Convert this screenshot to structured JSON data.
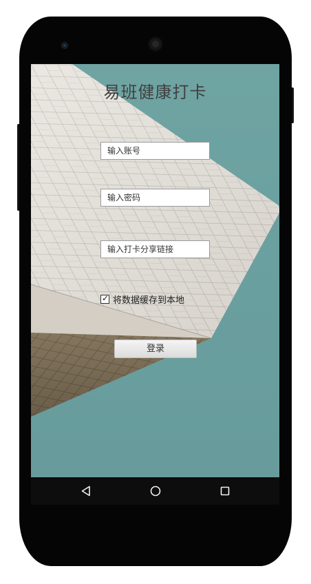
{
  "app": {
    "title": "易班健康打卡"
  },
  "form": {
    "account_placeholder": "输入账号",
    "password_placeholder": "输入密码",
    "link_placeholder": "输入打卡分享链接",
    "remember_label": "将数据缓存到本地",
    "remember_checked": true,
    "login_label": "登录"
  },
  "navbar": {
    "back_icon": "back-triangle-icon",
    "home_icon": "home-circle-icon",
    "recent_icon": "recent-square-icon"
  },
  "colors": {
    "screen_background": "#6fa4a3",
    "building_facade": "#e6e2dc",
    "phone_body": "#050505"
  }
}
